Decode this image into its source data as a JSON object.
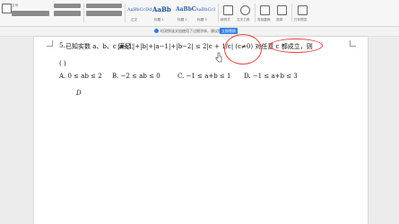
{
  "ribbon": {
    "font_size_label": "五号",
    "style_samples": [
      "AaBbCcDd",
      "AaBb",
      "AaBbC",
      "AaBbCcI"
    ],
    "style_names": [
      "正文",
      "标题 1",
      "标题 2",
      "标题 3"
    ],
    "group_labels": [
      "新样式",
      "文字工具",
      "查找替换",
      "选择",
      "打印预览"
    ]
  },
  "notice": {
    "text": "  检测到该文档使用了过期字体，建议替换",
    "button": "立即替换"
  },
  "question": {
    "number": "5.",
    "stem": "已知实数 a、b、c 满足：",
    "condition": "|a+1|+|b|+|a−1|+|b−2| ≤ 2|c + 1/c| (c≠0) 对任意 c 都成立，则",
    "blank": "(      )",
    "options": [
      "A. 0 ≤ ab ≤ 2",
      "B.  −2 ≤ ab ≤ 0",
      "C. −1 ≤ a+b ≤ 1",
      "D. −1 ≤ a+b ≤ 3"
    ],
    "answer": "D"
  },
  "colors": {
    "annotation": "#e8433a",
    "accent": "#2f7de1"
  }
}
